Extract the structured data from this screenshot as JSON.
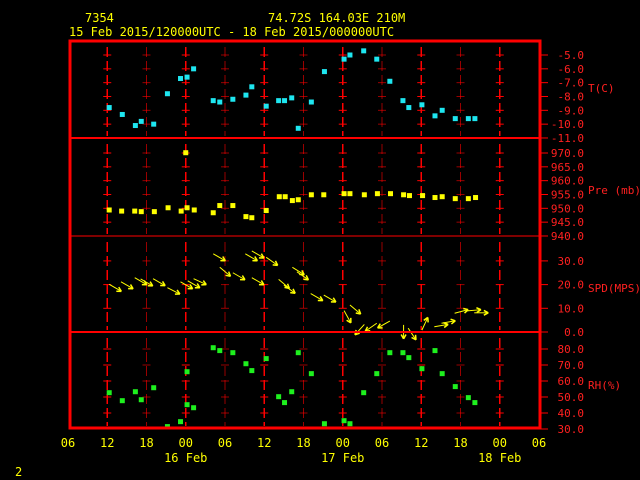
{
  "header": {
    "station": "7354",
    "location": "74.72S   164.03E   210M",
    "period": "15 Feb 2015/120000UTC - 18 Feb 2015/000000UTC"
  },
  "footer": {
    "page": "2"
  },
  "colors": {
    "frame": "#ff0000",
    "text": "#ffff00",
    "temp": "#1ee6f0",
    "pressure": "#ffff00",
    "wind": "#ffff00",
    "rh": "#1ef01e"
  },
  "chart_data": {
    "type": "scatter",
    "title": "7354  74.72S 164.03E 210M",
    "subtitle": "15 Feb 2015/120000UTC - 18 Feb 2015/000000UTC",
    "x_unit": "hours since 15 Feb 2015 06UTC",
    "xlim": [
      0,
      72
    ],
    "x_ticks": [
      {
        "h": 0,
        "label": "06"
      },
      {
        "h": 6,
        "label": "12"
      },
      {
        "h": 12,
        "label": "18"
      },
      {
        "h": 18,
        "label": "00",
        "date": "16 Feb"
      },
      {
        "h": 24,
        "label": "06"
      },
      {
        "h": 30,
        "label": "12"
      },
      {
        "h": 36,
        "label": "18"
      },
      {
        "h": 42,
        "label": "00",
        "date": "17 Feb"
      },
      {
        "h": 48,
        "label": "06"
      },
      {
        "h": 54,
        "label": "12"
      },
      {
        "h": 60,
        "label": "18"
      },
      {
        "h": 66,
        "label": "00",
        "date": "18 Feb"
      },
      {
        "h": 72,
        "label": "06"
      }
    ],
    "panels": [
      {
        "id": "temperature",
        "ylabel": "T(C)",
        "ylim": [
          -11,
          -5
        ],
        "ticks": [
          "-5.0",
          "-6.0",
          "-7.0",
          "-8.0",
          "-9.0",
          "-10.0",
          "-11.0"
        ],
        "points": [
          [
            6.3,
            -8.8
          ],
          [
            8.3,
            -9.3
          ],
          [
            10.3,
            -10.1
          ],
          [
            11.2,
            -9.8
          ],
          [
            13.1,
            -10.0
          ],
          [
            15.2,
            -7.8
          ],
          [
            17.2,
            -6.7
          ],
          [
            18.2,
            -6.6
          ],
          [
            19.2,
            -6.0
          ],
          [
            22.2,
            -8.3
          ],
          [
            23.2,
            -8.4
          ],
          [
            25.2,
            -8.2
          ],
          [
            27.2,
            -7.9
          ],
          [
            28.1,
            -7.3
          ],
          [
            30.3,
            -8.7
          ],
          [
            32.2,
            -8.3
          ],
          [
            33.1,
            -8.3
          ],
          [
            34.2,
            -8.1
          ],
          [
            35.2,
            -10.3
          ],
          [
            37.2,
            -8.4
          ],
          [
            39.2,
            -6.2
          ],
          [
            42.2,
            -5.3
          ],
          [
            43.1,
            -5.0
          ],
          [
            45.2,
            -4.7
          ],
          [
            47.2,
            -5.3
          ],
          [
            49.2,
            -6.9
          ],
          [
            51.2,
            -8.3
          ],
          [
            52.1,
            -8.8
          ],
          [
            54.1,
            -8.6
          ],
          [
            56.1,
            -9.4
          ],
          [
            57.2,
            -9.0
          ],
          [
            59.2,
            -9.6
          ],
          [
            61.2,
            -9.6
          ],
          [
            62.2,
            -9.6
          ]
        ]
      },
      {
        "id": "pressure",
        "ylabel": "Pre (mb)",
        "ylim": [
          940,
          970
        ],
        "ticks": [
          "970.0",
          "965.0",
          "960.0",
          "955.0",
          "950.0",
          "945.0",
          "940.0"
        ],
        "points": [
          [
            6.3,
            949.4
          ],
          [
            8.2,
            949.0
          ],
          [
            10.2,
            949.0
          ],
          [
            11.2,
            948.8
          ],
          [
            13.2,
            948.8
          ],
          [
            15.3,
            950.2
          ],
          [
            17.3,
            949.0
          ],
          [
            18.2,
            950.2
          ],
          [
            18.0,
            970.1
          ],
          [
            19.3,
            949.4
          ],
          [
            22.2,
            948.4
          ],
          [
            23.2,
            951.0
          ],
          [
            25.2,
            951.0
          ],
          [
            27.2,
            947.0
          ],
          [
            28.1,
            946.6
          ],
          [
            30.3,
            949.2
          ],
          [
            32.3,
            954.2
          ],
          [
            33.2,
            954.2
          ],
          [
            34.3,
            952.8
          ],
          [
            35.2,
            953.1
          ],
          [
            37.2,
            954.9
          ],
          [
            39.1,
            954.9
          ],
          [
            42.2,
            955.3
          ],
          [
            43.1,
            955.3
          ],
          [
            45.3,
            954.9
          ],
          [
            47.3,
            955.3
          ],
          [
            49.3,
            955.3
          ],
          [
            51.3,
            954.9
          ],
          [
            52.2,
            954.6
          ],
          [
            54.2,
            954.6
          ],
          [
            56.1,
            953.9
          ],
          [
            57.2,
            954.2
          ],
          [
            59.2,
            953.5
          ],
          [
            61.2,
            953.5
          ],
          [
            62.3,
            953.9
          ]
        ]
      },
      {
        "id": "wind",
        "ylabel": "SPD(MPS)",
        "ylim": [
          0,
          40
        ],
        "ticks": [
          "30.0",
          "20.0",
          "10.0",
          "0.0"
        ],
        "arrows_note": "speed with direction arrow (compass degrees the arrow points to)",
        "points": [
          [
            6.3,
            20.1,
            120
          ],
          [
            8.1,
            21.2,
            120
          ],
          [
            10.2,
            22.9,
            120
          ],
          [
            11.1,
            22.4,
            120
          ],
          [
            13.0,
            22.5,
            120
          ],
          [
            15.2,
            18.7,
            117
          ],
          [
            17.2,
            21.2,
            120
          ],
          [
            18.3,
            21.6,
            120
          ],
          [
            19.2,
            22.5,
            115
          ],
          [
            22.2,
            33.0,
            120
          ],
          [
            23.2,
            27.3,
            130
          ],
          [
            25.2,
            25.0,
            120
          ],
          [
            27.1,
            33.0,
            120
          ],
          [
            28.1,
            34.2,
            120
          ],
          [
            28.1,
            22.9,
            120
          ],
          [
            30.3,
            31.5,
            125
          ],
          [
            32.2,
            22.2,
            130
          ],
          [
            33.0,
            19.8,
            126
          ],
          [
            34.3,
            27.3,
            122
          ],
          [
            35.0,
            25.4,
            125
          ],
          [
            37.1,
            16.2,
            120
          ],
          [
            39.1,
            15.6,
            120
          ],
          [
            43.1,
            11.4,
            130
          ],
          [
            42.2,
            9.0,
            151
          ],
          [
            45.3,
            3.2,
            222
          ],
          [
            47.2,
            3.7,
            235
          ],
          [
            49.2,
            4.6,
            241
          ],
          [
            51.3,
            3.0,
            180
          ],
          [
            52.0,
            1.6,
            146
          ],
          [
            54.1,
            0.8,
            25
          ],
          [
            56.0,
            2.2,
            80
          ],
          [
            57.1,
            3.7,
            80
          ],
          [
            59.1,
            7.9,
            75
          ],
          [
            61.0,
            8.9,
            85
          ],
          [
            62.1,
            8.1,
            90
          ]
        ]
      },
      {
        "id": "rh",
        "ylabel": "RH(%)",
        "ylim": [
          30,
          80
        ],
        "ticks": [
          "80.0",
          "70.0",
          "60.0",
          "50.0",
          "40.0",
          "30.0"
        ],
        "points": [
          [
            6.3,
            52.7
          ],
          [
            8.3,
            47.7
          ],
          [
            10.3,
            53.3
          ],
          [
            11.2,
            48.3
          ],
          [
            13.1,
            55.8
          ],
          [
            15.2,
            31.5
          ],
          [
            17.2,
            34.6
          ],
          [
            18.2,
            65.8
          ],
          [
            18.2,
            45.2
          ],
          [
            19.2,
            43.3
          ],
          [
            22.2,
            80.8
          ],
          [
            23.2,
            79.0
          ],
          [
            25.2,
            77.7
          ],
          [
            27.2,
            70.8
          ],
          [
            28.1,
            66.5
          ],
          [
            30.3,
            74.0
          ],
          [
            32.2,
            50.2
          ],
          [
            33.1,
            46.5
          ],
          [
            34.2,
            53.3
          ],
          [
            35.2,
            77.7
          ],
          [
            37.2,
            64.6
          ],
          [
            39.2,
            33.3
          ],
          [
            42.2,
            35.2
          ],
          [
            43.1,
            33.3
          ],
          [
            45.2,
            52.7
          ],
          [
            47.2,
            64.6
          ],
          [
            49.2,
            77.7
          ],
          [
            51.2,
            77.7
          ],
          [
            52.1,
            74.6
          ],
          [
            54.1,
            67.7
          ],
          [
            56.1,
            79.0
          ],
          [
            57.2,
            64.6
          ],
          [
            59.2,
            56.5
          ],
          [
            61.2,
            49.6
          ],
          [
            62.2,
            46.5
          ]
        ]
      }
    ]
  }
}
